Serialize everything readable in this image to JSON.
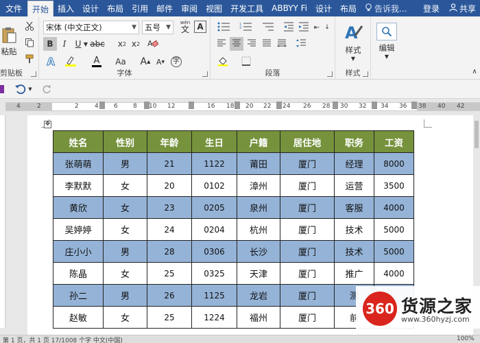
{
  "tabs": [
    {
      "label": "文件",
      "active": false
    },
    {
      "label": "开始",
      "active": true
    },
    {
      "label": "插入",
      "active": false
    },
    {
      "label": "设计",
      "active": false
    },
    {
      "label": "布局",
      "active": false
    },
    {
      "label": "引用",
      "active": false
    },
    {
      "label": "邮件",
      "active": false
    },
    {
      "label": "审阅",
      "active": false
    },
    {
      "label": "视图",
      "active": false
    },
    {
      "label": "开发工具",
      "active": false
    },
    {
      "label": "ABBYY Fi",
      "active": false
    },
    {
      "label": "设计",
      "active": false
    },
    {
      "label": "布局",
      "active": false
    }
  ],
  "tell_me": "告诉我...",
  "login_label": "登录",
  "share_label": "共享",
  "ribbon": {
    "paste_label": "粘贴",
    "clipboard_label": "剪贴板",
    "font_name": "宋体 (中文正文)",
    "font_size": "五号",
    "wen_char": "wén",
    "font_label": "字体",
    "paragraph_label": "段落",
    "styles_btn_label": "样式",
    "styles_label": "样式",
    "edit_label": "编辑"
  },
  "ruler_numbers": [
    "4",
    "2",
    "2",
    "4",
    "6",
    "8",
    "10",
    "12",
    "16",
    "18",
    "20",
    "22",
    "24",
    "26",
    "28",
    "30",
    "32",
    "34",
    "36",
    "38",
    "40",
    "42"
  ],
  "table": {
    "headers": [
      "姓名",
      "性别",
      "年龄",
      "生日",
      "户籍",
      "居住地",
      "职务",
      "工资"
    ],
    "rows": [
      [
        "张萌萌",
        "男",
        "21",
        "1122",
        "莆田",
        "厦门",
        "经理",
        "8000"
      ],
      [
        "李默默",
        "女",
        "20",
        "0102",
        "漳州",
        "厦门",
        "运营",
        "3500"
      ],
      [
        "黄欣",
        "女",
        "23",
        "0205",
        "泉州",
        "厦门",
        "客服",
        "4000"
      ],
      [
        "吴婷婷",
        "女",
        "24",
        "0204",
        "杭州",
        "厦门",
        "技术",
        "5000"
      ],
      [
        "庄小小",
        "男",
        "28",
        "0306",
        "长沙",
        "厦门",
        "技术",
        "5000"
      ],
      [
        "陈晶",
        "女",
        "25",
        "0325",
        "天津",
        "厦门",
        "推广",
        "4000"
      ],
      [
        "孙二",
        "男",
        "26",
        "1125",
        "龙岩",
        "厦门",
        "测",
        ""
      ],
      [
        "赵敏",
        "女",
        "25",
        "1224",
        "福州",
        "厦门",
        "前",
        ""
      ]
    ],
    "highlighted_rows": [
      0,
      2,
      4,
      6
    ]
  },
  "statusbar": {
    "left": "第 1 页，共 1 页    17/1008 个字    中文(中国)",
    "zoom": "100%"
  },
  "watermark": {
    "logo": "360",
    "name": "货源之家",
    "url": "www.360hyzj.com"
  },
  "colors": {
    "accent": "#2b579a",
    "header_fill": "#76923c",
    "row_highlight": "#95b3d7",
    "watermark_red": "#d9251d"
  }
}
